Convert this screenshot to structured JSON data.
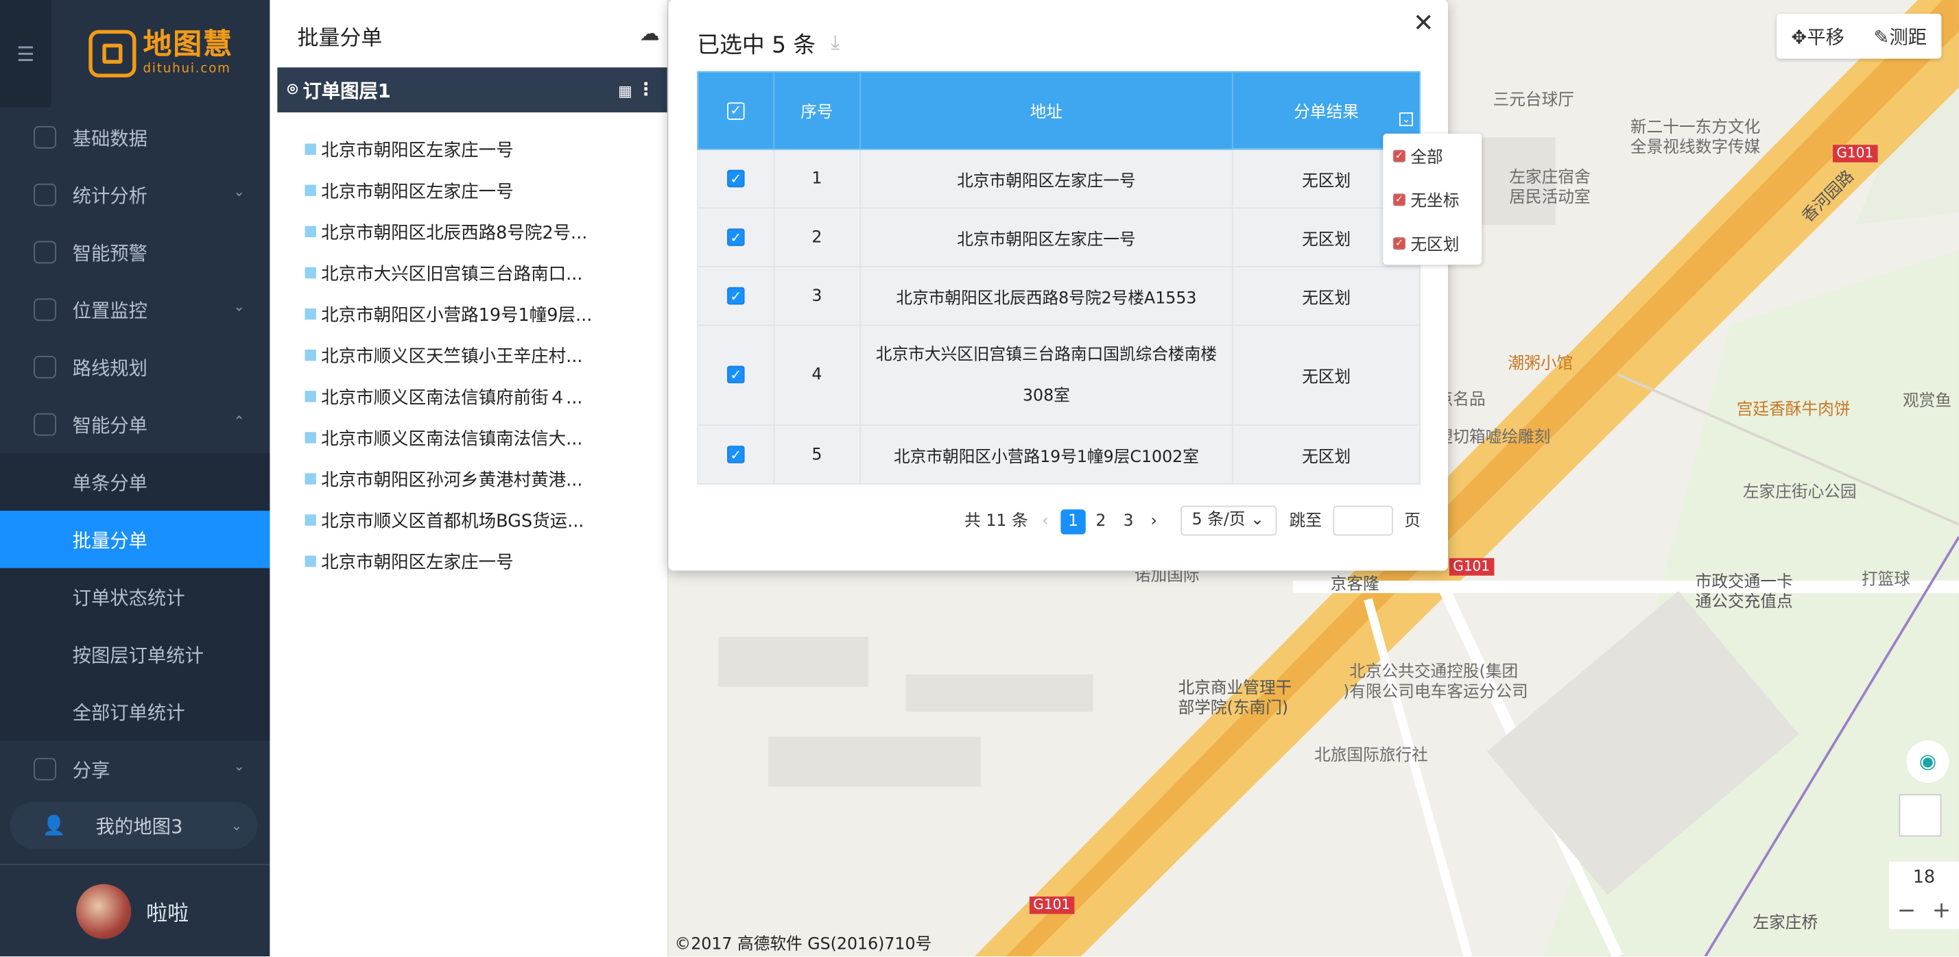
{
  "sidebar": {
    "toggle_icon": "menu-fold-icon",
    "logo_title": "地图慧",
    "logo_sub": "dituhui.com",
    "items": [
      {
        "label": "基础数据",
        "icon": "home-icon"
      },
      {
        "label": "统计分析",
        "icon": "chart-icon",
        "expandable": true
      },
      {
        "label": "智能预警",
        "icon": "alert-icon"
      },
      {
        "label": "位置监控",
        "icon": "location-icon",
        "expandable": true
      },
      {
        "label": "路线规划",
        "icon": "route-icon"
      },
      {
        "label": "智能分单",
        "icon": "order-icon",
        "expanded": true
      }
    ],
    "sub_items": [
      "单条分单",
      "批量分单",
      "订单状态统计",
      "按图层订单统计",
      "全部订单统计"
    ],
    "active_sub": "批量分单",
    "share": "分享",
    "mymap": "我的地图3",
    "user": "啦啦"
  },
  "panel": {
    "title": "批量分单",
    "layer_name": "订单图层1",
    "orders": [
      "北京市朝阳区左家庄一号",
      "北京市朝阳区左家庄一号",
      "北京市朝阳区北辰西路8号院2号...",
      "北京市大兴区旧宫镇三台路南口...",
      "北京市朝阳区小营路19号1幢9层...",
      "北京市顺义区天竺镇小王辛庄村...",
      "北京市顺义区南法信镇府前街４...",
      "北京市顺义区南法信镇南法信大...",
      "北京市朝阳区孙河乡黄港村黄港...",
      "北京市顺义区首都机场BGS货运...",
      "北京市朝阳区左家庄一号"
    ]
  },
  "modal": {
    "title": "已选中 5 条",
    "columns": [
      "序号",
      "地址",
      "分单结果"
    ],
    "rows": [
      {
        "no": "1",
        "address": "北京市朝阳区左家庄一号",
        "result": "无区划"
      },
      {
        "no": "2",
        "address": "北京市朝阳区左家庄一号",
        "result": "无区划"
      },
      {
        "no": "3",
        "address": "北京市朝阳区北辰西路8号院2号楼A1553",
        "result": "无区划"
      },
      {
        "no": "4",
        "address": "北京市大兴区旧宫镇三台路南口国凯综合楼南楼308室",
        "result": "无区划"
      },
      {
        "no": "5",
        "address": "北京市朝阳区小营路19号1幢9层C1002室",
        "result": "无区划"
      }
    ],
    "filter_options": [
      "全部",
      "无坐标",
      "无区划"
    ],
    "pager": {
      "total": "共 11 条",
      "pages": [
        "1",
        "2",
        "3"
      ],
      "current": "1",
      "page_size": "5 条/页",
      "jump_label": "跳至",
      "page_suffix": "页"
    }
  },
  "map": {
    "tools": [
      "平移",
      "测距"
    ],
    "zoom": "18",
    "copyright": "©2017 高德软件 GS(2016)710号",
    "labels": [
      "三元台球厅",
      "新二十一东方文化",
      "全景视线数字传媒",
      "左家庄宿舍",
      "居民活动室",
      "潮粥小馆",
      "宫廷香酥牛肉饼",
      "观赏鱼",
      "左家庄街心公园",
      "市政交通一卡",
      "通公交充值点",
      "打篮球",
      "京客隆",
      "北京商业管理干",
      "部学院(东南门)",
      "北京公共交通控股(集团",
      ")有限公司电车客运分公司",
      "北旅国际旅行社",
      "左家庄桥",
      "诺加国际",
      "饮点名品",
      "极塑切箱嘘绘雕刻",
      "香河园路",
      "G101"
    ]
  }
}
